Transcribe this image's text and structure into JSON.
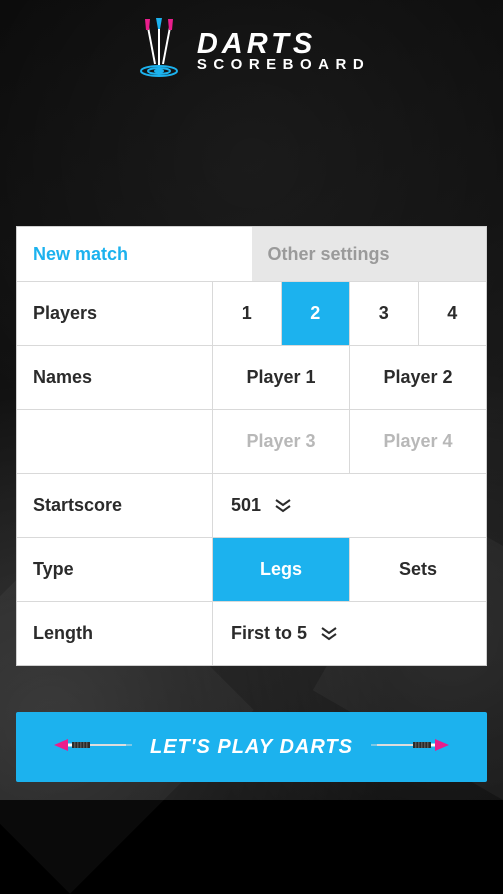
{
  "logo": {
    "line1": "DARTS",
    "line2": "SCOREBOARD"
  },
  "tabs": {
    "new_match": "New match",
    "other_settings": "Other settings",
    "active": "new_match"
  },
  "players": {
    "label": "Players",
    "options": [
      "1",
      "2",
      "3",
      "4"
    ],
    "selected": "2"
  },
  "names": {
    "label": "Names",
    "values": [
      "Player 1",
      "Player 2"
    ],
    "placeholders": [
      "Player 3",
      "Player 4"
    ]
  },
  "startscore": {
    "label": "Startscore",
    "value": "501"
  },
  "type": {
    "label": "Type",
    "options": [
      "Legs",
      "Sets"
    ],
    "selected": "Legs"
  },
  "length": {
    "label": "Length",
    "value": "First to 5"
  },
  "play_button": "LET'S PLAY DARTS",
  "colors": {
    "accent": "#1cb2ee"
  }
}
